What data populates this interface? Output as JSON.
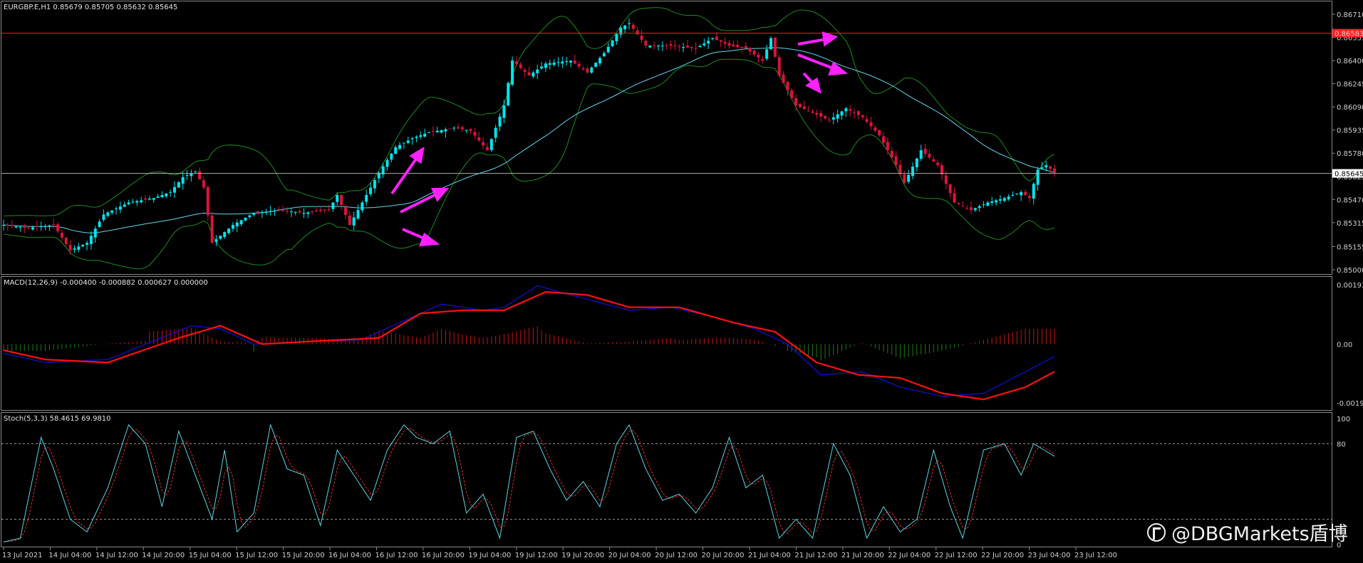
{
  "colors": {
    "background": "#000000",
    "bull_candle": "#00e5ee",
    "bear_candle": "#dc143c",
    "bollinger": "#1f8a1f",
    "moving_average": "#63d8ef",
    "macd_line": "#1010e0",
    "macd_signal": "#ff1010",
    "macd_hist_pos": "#c81414",
    "macd_hist_neg": "#1d7a1d",
    "stoch_main": "#5fd6e0",
    "stoch_signal": "#e03030",
    "arrows": "#ff20ff",
    "alert_line": "#ff2020",
    "bid_line": "#b0b0b0",
    "grid": "#5a5a5a"
  },
  "header": {
    "price": "EURGBP.E,H1  0.85679 0.85705 0.85632 0.85645",
    "macd": "MACD(12,26,9) -0.000400 -0.000882 0.000627 0.000000",
    "stoch": "Stoch(5,3,3) 58.4615 69.9810"
  },
  "axes": {
    "price_ticks": [
      "0.86710",
      "0.86555",
      "0.86400",
      "0.86245",
      "0.86090",
      "0.85935",
      "0.85780",
      "0.85625",
      "0.85470",
      "0.85315",
      "0.85155",
      "0.85000"
    ],
    "alert_price": "0.86583",
    "bid_price": "0.85645",
    "macd_ticks": [
      "0.001933",
      "0.00",
      "-0.001908"
    ],
    "stoch_ticks": [
      "100",
      "80",
      "0"
    ],
    "time_ticks": [
      "13 Jul 2021",
      "14 Jul 04:00",
      "14 Jul 12:00",
      "14 Jul 20:00",
      "15 Jul 04:00",
      "15 Jul 12:00",
      "15 Jul 20:00",
      "16 Jul 04:00",
      "16 Jul 12:00",
      "16 Jul 20:00",
      "19 Jul 04:00",
      "19 Jul 12:00",
      "19 Jul 20:00",
      "20 Jul 04:00",
      "20 Jul 12:00",
      "20 Jul 20:00",
      "21 Jul 04:00",
      "21 Jul 12:00",
      "21 Jul 20:00",
      "22 Jul 04:00",
      "22 Jul 12:00",
      "22 Jul 20:00",
      "23 Jul 04:00",
      "23 Jul 12:00"
    ]
  },
  "watermark": "@DBGMarkets盾博",
  "chart_data": [
    {
      "type": "candlestick",
      "symbol": "EURGBP.E",
      "timeframe": "H1",
      "ylim": [
        0.85,
        0.8674
      ],
      "close_anchors": [
        [
          0,
          0.853
        ],
        [
          6,
          0.8528
        ],
        [
          12,
          0.853
        ],
        [
          16,
          0.8513
        ],
        [
          20,
          0.8518
        ],
        [
          24,
          0.8537
        ],
        [
          30,
          0.8545
        ],
        [
          36,
          0.8548
        ],
        [
          40,
          0.8552
        ],
        [
          43,
          0.8562
        ],
        [
          46,
          0.8566
        ],
        [
          48,
          0.8555
        ],
        [
          50,
          0.8518
        ],
        [
          55,
          0.853
        ],
        [
          60,
          0.8538
        ],
        [
          66,
          0.854
        ],
        [
          72,
          0.8538
        ],
        [
          78,
          0.854
        ],
        [
          80,
          0.855
        ],
        [
          83,
          0.853
        ],
        [
          86,
          0.8545
        ],
        [
          90,
          0.8565
        ],
        [
          94,
          0.8582
        ],
        [
          98,
          0.8588
        ],
        [
          102,
          0.8592
        ],
        [
          108,
          0.8595
        ],
        [
          112,
          0.8593
        ],
        [
          116,
          0.858
        ],
        [
          120,
          0.861
        ],
        [
          122,
          0.864
        ],
        [
          126,
          0.863
        ],
        [
          130,
          0.8638
        ],
        [
          136,
          0.864
        ],
        [
          140,
          0.8632
        ],
        [
          144,
          0.8645
        ],
        [
          148,
          0.8662
        ],
        [
          150,
          0.8665
        ],
        [
          154,
          0.865
        ],
        [
          160,
          0.865
        ],
        [
          166,
          0.8648
        ],
        [
          170,
          0.8655
        ],
        [
          174,
          0.865
        ],
        [
          178,
          0.8648
        ],
        [
          182,
          0.864
        ],
        [
          184,
          0.8655
        ],
        [
          186,
          0.863
        ],
        [
          190,
          0.861
        ],
        [
          194,
          0.8605
        ],
        [
          198,
          0.86
        ],
        [
          202,
          0.8608
        ],
        [
          206,
          0.8602
        ],
        [
          210,
          0.859
        ],
        [
          214,
          0.857
        ],
        [
          216,
          0.8558
        ],
        [
          220,
          0.858
        ],
        [
          224,
          0.857
        ],
        [
          228,
          0.8545
        ],
        [
          232,
          0.854
        ],
        [
          236,
          0.8545
        ],
        [
          240,
          0.8548
        ],
        [
          244,
          0.8552
        ],
        [
          246,
          0.8548
        ],
        [
          248,
          0.8567
        ],
        [
          250,
          0.857
        ],
        [
          252,
          0.8565
        ]
      ],
      "alert_level": 0.86583,
      "bid": 0.85645
    },
    {
      "type": "line",
      "name": "MACD(12,26,9)",
      "ylim": [
        -0.00205,
        0.00205
      ],
      "macd_anchors": [
        [
          0,
          -0.0003
        ],
        [
          10,
          -0.0006
        ],
        [
          25,
          -0.0005
        ],
        [
          45,
          0.0006
        ],
        [
          52,
          0.0005
        ],
        [
          60,
          0.0
        ],
        [
          75,
          0.0001
        ],
        [
          85,
          0.0001
        ],
        [
          95,
          0.0007
        ],
        [
          105,
          0.0013
        ],
        [
          115,
          0.0011
        ],
        [
          120,
          0.0012
        ],
        [
          128,
          0.0019
        ],
        [
          136,
          0.0016
        ],
        [
          150,
          0.0011
        ],
        [
          160,
          0.0012
        ],
        [
          170,
          0.0009
        ],
        [
          180,
          0.0005
        ],
        [
          188,
          0.0
        ],
        [
          196,
          -0.001
        ],
        [
          206,
          -0.0009
        ],
        [
          215,
          -0.0014
        ],
        [
          225,
          -0.0017
        ],
        [
          235,
          -0.0016
        ],
        [
          245,
          -0.0009
        ],
        [
          252,
          -0.0004
        ]
      ],
      "signal_anchors": [
        [
          0,
          -0.0002
        ],
        [
          10,
          -0.0005
        ],
        [
          25,
          -0.0006
        ],
        [
          42,
          0.0002
        ],
        [
          52,
          0.0006
        ],
        [
          62,
          0.0
        ],
        [
          75,
          0.0001
        ],
        [
          90,
          0.0002
        ],
        [
          100,
          0.001
        ],
        [
          110,
          0.0011
        ],
        [
          120,
          0.0011
        ],
        [
          130,
          0.0017
        ],
        [
          140,
          0.0016
        ],
        [
          150,
          0.0012
        ],
        [
          162,
          0.0012
        ],
        [
          175,
          0.0007
        ],
        [
          185,
          0.0004
        ],
        [
          195,
          -0.0006
        ],
        [
          205,
          -0.001
        ],
        [
          215,
          -0.0011
        ],
        [
          225,
          -0.0016
        ],
        [
          235,
          -0.0018
        ],
        [
          245,
          -0.0014
        ],
        [
          252,
          -0.0009
        ]
      ]
    },
    {
      "type": "line",
      "name": "Stoch(5,3,3)",
      "ylim": [
        0,
        100
      ],
      "levels": [
        20,
        80
      ],
      "main_anchors": [
        [
          0,
          2
        ],
        [
          4,
          5
        ],
        [
          9,
          85
        ],
        [
          12,
          60
        ],
        [
          16,
          20
        ],
        [
          20,
          10
        ],
        [
          25,
          45
        ],
        [
          30,
          95
        ],
        [
          34,
          80
        ],
        [
          38,
          30
        ],
        [
          42,
          90
        ],
        [
          46,
          55
        ],
        [
          50,
          20
        ],
        [
          53,
          75
        ],
        [
          56,
          10
        ],
        [
          60,
          25
        ],
        [
          64,
          95
        ],
        [
          68,
          60
        ],
        [
          72,
          55
        ],
        [
          76,
          15
        ],
        [
          80,
          75
        ],
        [
          84,
          55
        ],
        [
          88,
          35
        ],
        [
          92,
          75
        ],
        [
          96,
          95
        ],
        [
          99,
          85
        ],
        [
          103,
          80
        ],
        [
          107,
          90
        ],
        [
          111,
          25
        ],
        [
          115,
          40
        ],
        [
          119,
          5
        ],
        [
          123,
          85
        ],
        [
          127,
          90
        ],
        [
          131,
          60
        ],
        [
          135,
          35
        ],
        [
          139,
          50
        ],
        [
          143,
          30
        ],
        [
          147,
          80
        ],
        [
          150,
          95
        ],
        [
          154,
          60
        ],
        [
          158,
          35
        ],
        [
          162,
          40
        ],
        [
          166,
          25
        ],
        [
          170,
          45
        ],
        [
          174,
          85
        ],
        [
          178,
          45
        ],
        [
          182,
          55
        ],
        [
          186,
          5
        ],
        [
          190,
          20
        ],
        [
          194,
          5
        ],
        [
          199,
          80
        ],
        [
          203,
          55
        ],
        [
          207,
          5
        ],
        [
          211,
          30
        ],
        [
          215,
          10
        ],
        [
          219,
          20
        ],
        [
          223,
          75
        ],
        [
          227,
          30
        ],
        [
          230,
          5
        ],
        [
          235,
          75
        ],
        [
          240,
          80
        ],
        [
          244,
          55
        ],
        [
          247,
          80
        ],
        [
          252,
          70
        ]
      ],
      "signal_lag": 2
    }
  ]
}
